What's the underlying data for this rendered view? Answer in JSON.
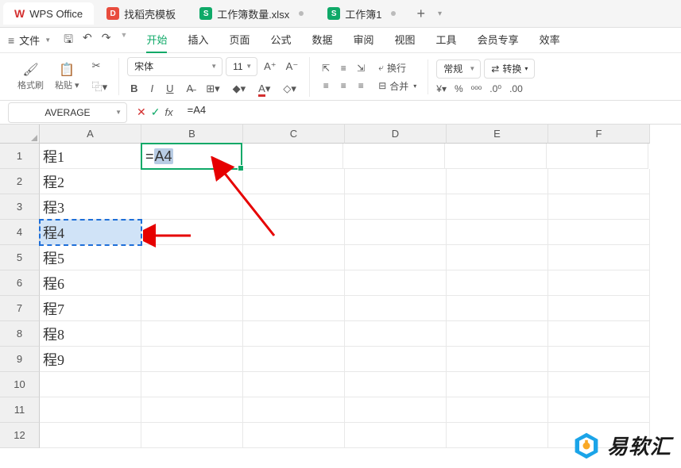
{
  "titlebar": {
    "app_name": "WPS Office",
    "tabs": [
      {
        "label": "找稻壳模板",
        "icon": "red"
      },
      {
        "label": "工作簿数量.xlsx",
        "icon": "green",
        "has_dot": true
      },
      {
        "label": "工作簿1",
        "icon": "green",
        "has_dot": true
      }
    ]
  },
  "menubar": {
    "file": "文件",
    "tabs": [
      "开始",
      "插入",
      "页面",
      "公式",
      "数据",
      "审阅",
      "视图",
      "工具",
      "会员专享",
      "效率"
    ],
    "active_index": 0
  },
  "toolbar": {
    "format_painter": "格式刷",
    "paste": "粘贴",
    "font_name": "宋体",
    "font_size": "11",
    "wrap": "换行",
    "merge": "合并",
    "number_format": "常规",
    "convert": "转换"
  },
  "formula_bar": {
    "name_box": "AVERAGE",
    "formula_prefix": "=",
    "formula_ref": "A4"
  },
  "grid": {
    "columns": [
      "A",
      "B",
      "C",
      "D",
      "E",
      "F"
    ],
    "rows": [
      "1",
      "2",
      "3",
      "4",
      "5",
      "6",
      "7",
      "8",
      "9",
      "10",
      "11",
      "12"
    ],
    "col_a": [
      "程1",
      "程2",
      "程3",
      "程4",
      "程5",
      "程6",
      "程7",
      "程8",
      "程9",
      "",
      "",
      ""
    ],
    "active_cell": "B1",
    "ants_cell": "A4",
    "b1_display_prefix": "=",
    "b1_display_ref": "A4"
  },
  "watermark": {
    "text": "易软汇"
  }
}
